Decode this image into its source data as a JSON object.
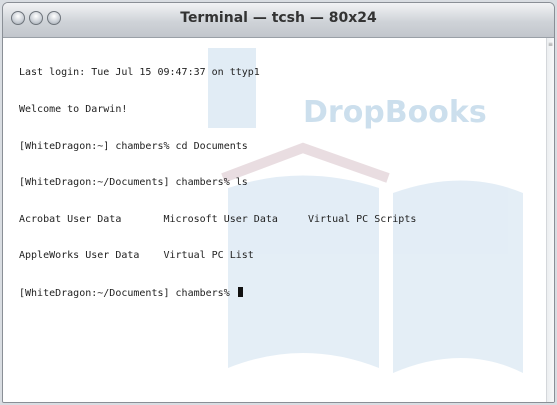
{
  "window": {
    "title": "Terminal — tcsh — 80x24",
    "buttons": [
      "close-button",
      "minimize-button",
      "zoom-button"
    ]
  },
  "terminal": {
    "lines": [
      "Last login: Tue Jul 15 09:47:37 on ttyp1",
      "Welcome to Darwin!",
      "[WhiteDragon:~] chambers% cd Documents",
      "[WhiteDragon:~/Documents] chambers% ls",
      "Acrobat User Data       Microsoft User Data     Virtual PC Scripts",
      "AppleWorks User Data    Virtual PC List",
      "[WhiteDragon:~/Documents] chambers% "
    ]
  },
  "watermark": {
    "text": "DropBooks",
    "color": "#8fb9d8"
  },
  "colors": {
    "terminal_text": "#222222",
    "background": "#ffffff"
  }
}
